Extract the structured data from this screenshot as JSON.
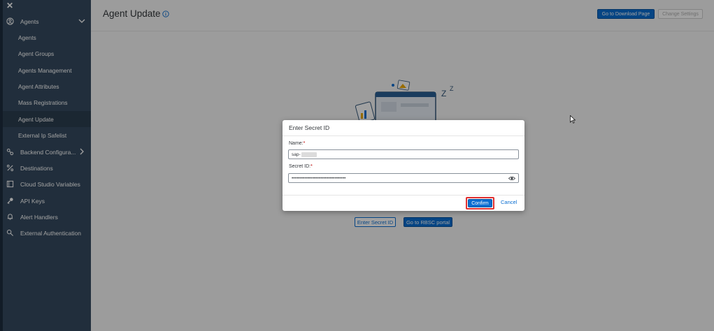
{
  "sidebar": {
    "close_glyph": "✕",
    "groups": [
      {
        "label": "Agents",
        "icon": "agent-icon",
        "chevron": "down"
      },
      {
        "label": "Backend Configura...",
        "icon": "backend-icon",
        "chevron": "right"
      },
      {
        "label": "Destinations",
        "icon": "destinations-icon"
      },
      {
        "label": "Cloud Studio Variables",
        "icon": "variables-icon"
      },
      {
        "label": "API Keys",
        "icon": "key-icon"
      },
      {
        "label": "Alert Handlers",
        "icon": "bell-icon"
      },
      {
        "label": "External Authentication",
        "icon": "auth-icon"
      }
    ],
    "sub_items": [
      {
        "label": "Agents"
      },
      {
        "label": "Agent Groups"
      },
      {
        "label": "Agents Management"
      },
      {
        "label": "Agent Attributes"
      },
      {
        "label": "Mass Registrations"
      },
      {
        "label": "Agent Update",
        "active": true
      },
      {
        "label": "External Ip Safelist"
      }
    ]
  },
  "header": {
    "title": "Agent Update",
    "download_label": "Go to Download Page",
    "change_settings_label": "Change Settings"
  },
  "main": {
    "enter_secret_label": "Enter Secret ID",
    "rbsc_label": "Go to RBSC portal"
  },
  "dialog": {
    "title": "Enter Secret ID",
    "name_label": "Name:",
    "name_value": "sap-",
    "secret_label": "Secret ID:",
    "secret_value": "••••••••••••••••••••••••••••••••••",
    "required_mark": "*",
    "confirm_label": "Confirm",
    "cancel_label": "Cancel"
  },
  "colors": {
    "sidebar_bg": "#354a5f",
    "accent": "#0a6ed1",
    "highlight_border": "#e03030",
    "required": "#bb0000"
  }
}
